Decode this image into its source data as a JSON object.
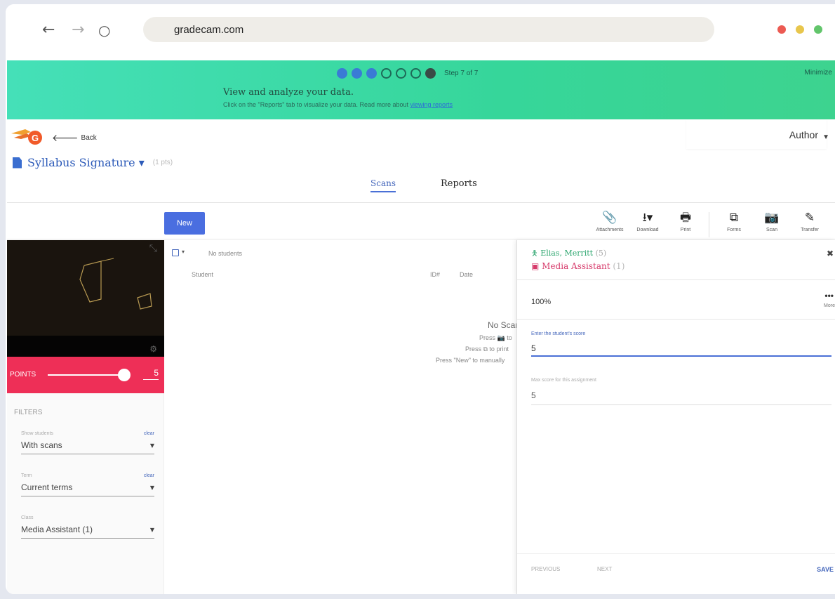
{
  "browser": {
    "url": "gradecam.com",
    "nav": {
      "back": "←",
      "forward": "→",
      "reload": "○"
    }
  },
  "banner": {
    "step_text": "Step 7 of 7",
    "right_text": "Minimize",
    "title": "View and analyze your data.",
    "subtitle": "Click on the \"Reports\" tab to visualize your data. Read more about ",
    "link": "viewing reports"
  },
  "header": {
    "back": "Back",
    "back_arrow": "🡐",
    "author": "Author",
    "author_caret": "▼",
    "doc_title": "Syllabus Signature ▾",
    "doc_count": "(1 pts)"
  },
  "tabs": {
    "scans": "Scans",
    "reports": "Reports"
  },
  "toolbar": {
    "new": "New",
    "tools": [
      {
        "icon": "📎",
        "label": "Attachments"
      },
      {
        "icon": "⭳▾",
        "label": "Download"
      },
      {
        "icon": "🖶",
        "label": "Print"
      },
      {
        "icon": "⧉",
        "label": "Forms"
      },
      {
        "icon": "📷",
        "label": "Scan"
      },
      {
        "icon": "✎",
        "label": "Transfer"
      }
    ]
  },
  "camera": {
    "expand": "⤡",
    "gear": "⚙"
  },
  "points": {
    "label": "POINTS",
    "value": "5",
    "fill": 0.89
  },
  "filters": {
    "title": "FILTERS",
    "items": [
      {
        "label": "Show students",
        "clear": "clear",
        "value": "With scans"
      },
      {
        "label": "Term",
        "clear": "clear",
        "value": "Current terms"
      },
      {
        "label": "Class",
        "clear": "",
        "value": "Media Assistant (1)"
      }
    ],
    "caret": "▼"
  },
  "list": {
    "select_caret": "▾",
    "no_students": "No students",
    "col_student": "Student",
    "col_id": "ID#",
    "col_date": "Date",
    "empty_title": "No Scans",
    "empty_lines": [
      "Press 📷 to",
      "Press ⧉ to print",
      "Press \"New\" to manually"
    ]
  },
  "panel": {
    "student_name": "Elias, Merritt",
    "student_count": "(5)",
    "class_name": "Media Assistant",
    "class_count": "(1)",
    "close": "✖",
    "percent": "100%",
    "more_icon": "•••",
    "more_label": "More",
    "score_label": "Enter the student's score",
    "score_value": "5",
    "max_label": "Max score for this assignment",
    "max_value": "5",
    "previous": "PREVIOUS",
    "next": "NEXT",
    "save": "SAVE"
  }
}
